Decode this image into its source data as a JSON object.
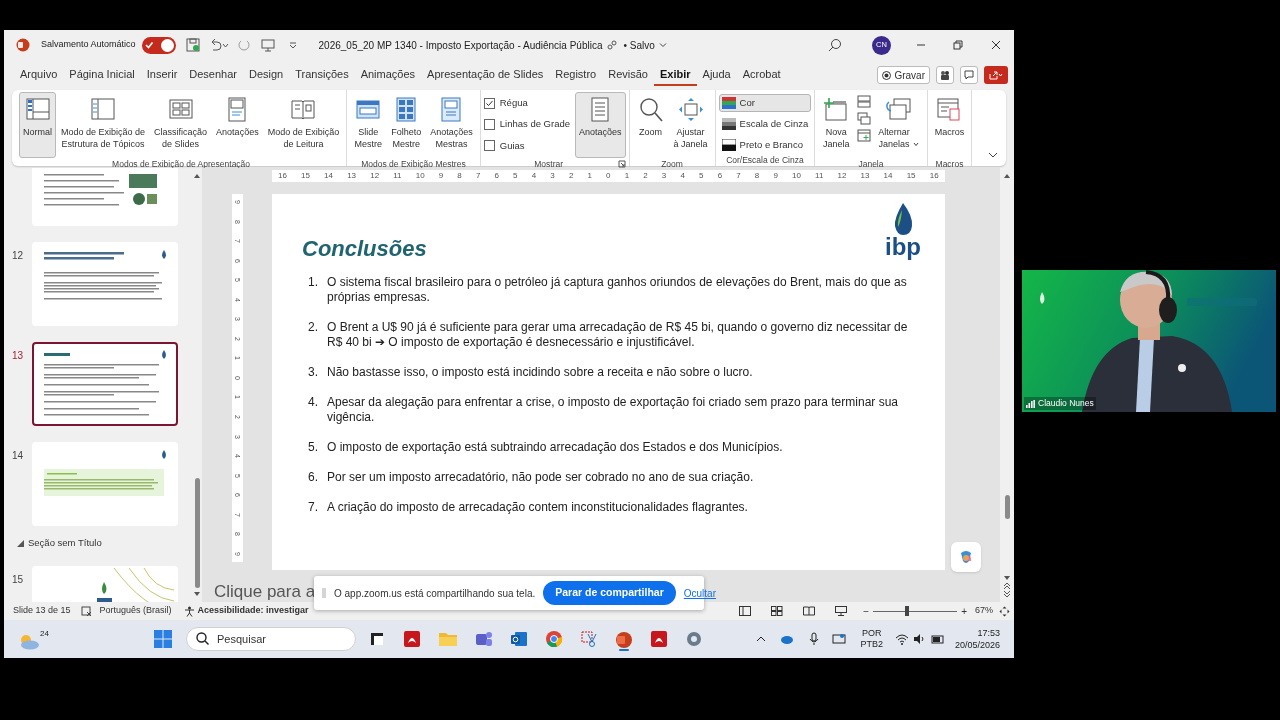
{
  "titlebar": {
    "autosave_label": "Salvamento Automático",
    "autosave_on": true,
    "title": "2026_05_20 MP 1340 - Imposto Exportação - Audiência Pública",
    "status": "• Salvo",
    "avatar": "CN"
  },
  "menu_tabs": [
    {
      "label": "Arquivo",
      "selected": false
    },
    {
      "label": "Página Inicial",
      "selected": false
    },
    {
      "label": "Inserir",
      "selected": false
    },
    {
      "label": "Desenhar",
      "selected": false
    },
    {
      "label": "Design",
      "selected": false
    },
    {
      "label": "Transições",
      "selected": false
    },
    {
      "label": "Animações",
      "selected": false
    },
    {
      "label": "Apresentação de Slides",
      "selected": false
    },
    {
      "label": "Registro",
      "selected": false
    },
    {
      "label": "Revisão",
      "selected": false
    },
    {
      "label": "Exibir",
      "selected": true
    },
    {
      "label": "Ajuda",
      "selected": false
    },
    {
      "label": "Acrobat",
      "selected": false
    }
  ],
  "record_button": "Gravar",
  "ribbon_groups": [
    {
      "label": "Modos de Exibição de Apresentação",
      "items": [
        {
          "kind": "big",
          "label": "Normal",
          "selected": true
        },
        {
          "kind": "big",
          "label": "Modo de Exibição de\nEstrutura de Tópicos",
          "selected": false
        },
        {
          "kind": "big",
          "label": "Classificação\nde Slides",
          "selected": false
        },
        {
          "kind": "big",
          "label": "Anotações",
          "selected": false
        },
        {
          "kind": "big",
          "label": "Modo de Exibição\nde Leitura",
          "selected": false
        }
      ]
    },
    {
      "label": "Modos de Exibição Mestres",
      "items": [
        {
          "kind": "big",
          "label": "Slide\nMestre",
          "selected": false
        },
        {
          "kind": "big",
          "label": "Folheto\nMestre",
          "selected": false
        },
        {
          "kind": "big",
          "label": "Anotações\nMestras",
          "selected": false
        }
      ]
    },
    {
      "label": "Mostrar",
      "has_launcher": true,
      "items": [
        {
          "kind": "checks",
          "options": [
            {
              "label": "Régua",
              "checked": true
            },
            {
              "label": "Linhas de Grade",
              "checked": false
            },
            {
              "label": "Guias",
              "checked": false
            }
          ]
        },
        {
          "kind": "big",
          "label": "Anotações",
          "selected": true
        }
      ]
    },
    {
      "label": "Zoom",
      "items": [
        {
          "kind": "big",
          "label": "Zoom",
          "selected": false
        },
        {
          "kind": "big",
          "label": "Ajustar\nà Janela",
          "selected": false
        }
      ]
    },
    {
      "label": "Cor/Escala de Cinza",
      "items": [
        {
          "kind": "rows",
          "options": [
            {
              "label": "Cor",
              "selected": true
            },
            {
              "label": "Escala de Cinza",
              "selected": false
            },
            {
              "label": "Preto e Branco",
              "selected": false
            }
          ]
        }
      ]
    },
    {
      "label": "Janela",
      "items": [
        {
          "kind": "big",
          "label": "Nova\nJanela",
          "selected": false
        },
        {
          "kind": "stack"
        },
        {
          "kind": "big",
          "label": "Alternar\nJanelas",
          "selected": false,
          "dropdown": true
        }
      ]
    },
    {
      "label": "Macros",
      "items": [
        {
          "kind": "big",
          "label": "Macros",
          "selected": false
        }
      ]
    }
  ],
  "slide_panel": [
    {
      "kind": "art",
      "selected": false
    },
    {
      "kind": "text",
      "number": "12",
      "selected": false
    },
    {
      "kind": "conclusions",
      "number": "13",
      "selected": true
    },
    {
      "kind": "note",
      "number": "14",
      "selected": false
    },
    {
      "kind": "section",
      "label": "Seção sem Título",
      "expanded": true
    },
    {
      "kind": "cover",
      "number": "15",
      "selected": false
    }
  ],
  "ruler_marks": [
    "16",
    "15",
    "14",
    "13",
    "12",
    "11",
    "10",
    "9",
    "8",
    "7",
    "6",
    "5",
    "4",
    "3",
    "2",
    "1",
    "0",
    "1",
    "2",
    "3",
    "4",
    "5",
    "6",
    "7",
    "8",
    "9",
    "10",
    "11",
    "12",
    "13",
    "14",
    "15",
    "16"
  ],
  "vertical_ruler_marks": [
    "9",
    "8",
    "7",
    "6",
    "5",
    "4",
    "3",
    "2",
    "1",
    "0",
    "1",
    "2",
    "3",
    "4",
    "5",
    "6",
    "7",
    "8",
    "9"
  ],
  "slide": {
    "title": "Conclusões",
    "logo": "ibp",
    "points": [
      {
        "number": "1.",
        "text": "O sistema fiscal brasileiro para o petróleo já captura ganhos oriundos de elevações do Brent, mais do que as próprias empresas."
      },
      {
        "number": "2.",
        "text": "O Brent a U$ 90 já é suficiente para gerar uma arrecadação de R$ 45 bi, quando o governo diz necessitar de R$ 40 bi  ➔  O imposto de exportação é desnecessário e injustificável."
      },
      {
        "number": "3.",
        "text": "Não bastasse isso, o imposto está incidindo sobre a receita e não sobre o lucro."
      },
      {
        "number": "4.",
        "text": "Apesar da alegação para enfrentar a crise, o imposto de exportação foi criado sem prazo para terminar sua vigência."
      },
      {
        "number": "5.",
        "text": "O imposto de exportação está subtraindo arrecadação dos Estados e dos Municípios."
      },
      {
        "number": "6.",
        "text": "Por ser um imposto arrecadatório, não pode ser cobrado no ano de sua criação."
      },
      {
        "number": "7.",
        "text": "A criação do imposto de arrecadação contem inconstitucionalidades flagrantes."
      }
    ]
  },
  "notes_placeholder": "Clique para a",
  "status_bar": {
    "slide": "Slide 13 de 15",
    "language": "Português (Brasil)",
    "accessibility": "Acessibilidade: investigar",
    "zoom_out": "−",
    "zoom_slider": {
      "level": 0.4
    },
    "zoom_in": "+",
    "zoom": "67%"
  },
  "share_banner": {
    "message": "O app.zoom.us está compartilhando sua tela.",
    "stop_button": "Parar de compartilhar",
    "hide_link": "Ocultar"
  },
  "taskbar": {
    "weather": "24",
    "search_placeholder": "Pesquisar",
    "language": "POR",
    "layout": "PTB2",
    "time": "17:53",
    "date": "20/05/2026"
  },
  "video": {
    "kind": "picture",
    "participant": "Claudio Nunes"
  }
}
